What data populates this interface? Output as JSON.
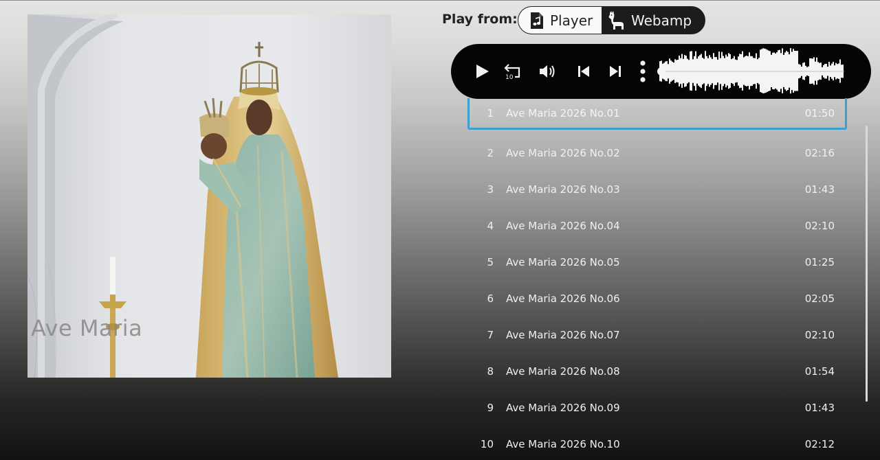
{
  "cover": {
    "overlay_text": "Ave Maria"
  },
  "play_from": {
    "label": "Play from:",
    "options": [
      {
        "label": "Player",
        "icon": "music-file-icon",
        "selected": true
      },
      {
        "label": "Webamp",
        "icon": "llama-icon",
        "selected": false
      }
    ]
  },
  "player": {
    "controls": [
      "play-icon",
      "replay-10-icon",
      "volume-icon",
      "previous-track-icon",
      "next-track-icon",
      "more-vertical-icon"
    ],
    "rewind_seconds": "10",
    "progress": 0.0
  },
  "playlist": {
    "tracks": [
      {
        "num": "1",
        "title": "Ave Maria 2026 No.01",
        "duration": "01:50",
        "active": true
      },
      {
        "num": "2",
        "title": "Ave Maria 2026 No.02",
        "duration": "02:16"
      },
      {
        "num": "3",
        "title": "Ave Maria 2026 No.03",
        "duration": "01:43"
      },
      {
        "num": "4",
        "title": "Ave Maria 2026 No.04",
        "duration": "02:10"
      },
      {
        "num": "5",
        "title": "Ave Maria 2026 No.05",
        "duration": "01:25"
      },
      {
        "num": "6",
        "title": "Ave Maria 2026 No.06",
        "duration": "02:05"
      },
      {
        "num": "7",
        "title": "Ave Maria 2026 No.07",
        "duration": "02:10"
      },
      {
        "num": "8",
        "title": "Ave Maria 2026 No.08",
        "duration": "01:54"
      },
      {
        "num": "9",
        "title": "Ave Maria 2026 No.09",
        "duration": "01:43"
      },
      {
        "num": "10",
        "title": "Ave Maria 2026 No.10",
        "duration": "02:12"
      }
    ]
  },
  "colors": {
    "active_border": "#3d9fd0",
    "player_bar": "#050505",
    "text_light": "#f0f0f0"
  }
}
